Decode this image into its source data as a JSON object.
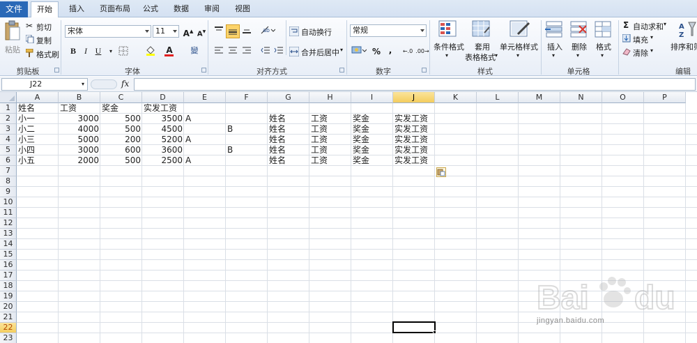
{
  "tabs": {
    "file": "文件",
    "items": [
      "开始",
      "插入",
      "页面布局",
      "公式",
      "数据",
      "审阅",
      "视图"
    ],
    "active": "开始"
  },
  "ribbon": {
    "clipboard": {
      "paste": "粘贴",
      "cut": "剪切",
      "copy": "复制",
      "format_painter": "格式刷",
      "label": "剪贴板"
    },
    "font": {
      "name": "宋体",
      "size": "11",
      "bold": "B",
      "italic": "I",
      "underline": "U",
      "label": "字体",
      "phonetic": "變"
    },
    "alignment": {
      "wrap_text": "自动换行",
      "merge_center": "合并后居中",
      "label": "对齐方式"
    },
    "number": {
      "format": "常规",
      "percent": "%",
      "comma": ",",
      "label": "数字"
    },
    "styles": {
      "conditional": "条件格式",
      "table_format_line1": "套用",
      "table_format_line2": "表格格式",
      "cell_styles": "单元格样式",
      "label": "样式"
    },
    "cells": {
      "insert": "插入",
      "delete": "删除",
      "format": "格式",
      "label": "单元格"
    },
    "editing": {
      "autosum": "自动求和",
      "fill": "填充",
      "clear": "清除",
      "sort_filter": "排序和筛",
      "label": "编辑"
    }
  },
  "formula_bar": {
    "cell_ref": "J22",
    "fx": "fx",
    "formula": ""
  },
  "sheet": {
    "columns": [
      "A",
      "B",
      "C",
      "D",
      "E",
      "F",
      "G",
      "H",
      "I",
      "J",
      "K",
      "L",
      "M",
      "N",
      "O",
      "P"
    ],
    "selected_column": "J",
    "rows": [
      "1",
      "2",
      "3",
      "4",
      "5",
      "6",
      "7",
      "8",
      "9",
      "10",
      "11",
      "12",
      "13",
      "14",
      "15",
      "16",
      "17",
      "18",
      "19",
      "20",
      "21",
      "22",
      "23"
    ],
    "selected_row": "22",
    "left_table": {
      "headers": [
        "姓名",
        "工资",
        "奖金",
        "实发工资"
      ],
      "rows": [
        [
          "小一",
          "3000",
          "500",
          "3500",
          "A",
          ""
        ],
        [
          "小二",
          "4000",
          "500",
          "4500",
          "",
          "B"
        ],
        [
          "小三",
          "5000",
          "200",
          "5200",
          "A",
          ""
        ],
        [
          "小四",
          "3000",
          "600",
          "3600",
          "",
          "B"
        ],
        [
          "小五",
          "2000",
          "500",
          "2500",
          "A",
          ""
        ]
      ]
    },
    "right_table": {
      "rows": [
        [
          "姓名",
          "工资",
          "奖金",
          "实发工资"
        ],
        [
          "姓名",
          "工资",
          "奖金",
          "实发工资"
        ],
        [
          "姓名",
          "工资",
          "奖金",
          "实发工资"
        ],
        [
          "姓名",
          "工资",
          "奖金",
          "实发工资"
        ],
        [
          "姓名",
          "工资",
          "奖金",
          "实发工资"
        ]
      ]
    }
  },
  "watermark": {
    "brand": "Bai du 经验",
    "url": "jingyan.baidu.com"
  },
  "colors": {
    "file_tab": "#2a69b7",
    "selection_header": "#f4cd5e",
    "active_row_text": "#b24a00"
  }
}
